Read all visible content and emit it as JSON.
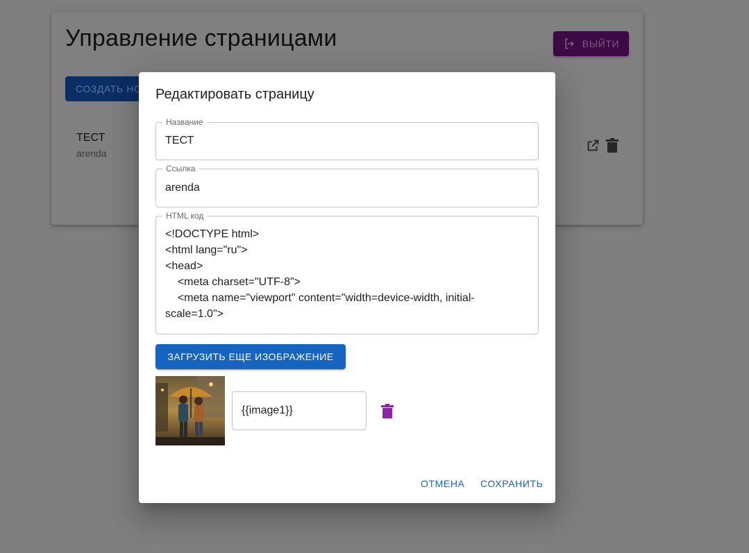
{
  "background": {
    "page_title": "Управление страницами",
    "logout_label": "ВЫЙТИ",
    "create_label": "СОЗДАТЬ НОВУЮ",
    "item_title": "ТЕСТ",
    "item_subtitle": "arenda"
  },
  "dialog": {
    "title": "Редактировать страницу",
    "name_label": "Название",
    "name_value": "ТЕСТ",
    "link_label": "Ссылка",
    "link_value": "arenda",
    "html_label": "HTML код",
    "html_value": "<!DOCTYPE html>\n<html lang=\"ru\">\n<head>\n    <meta charset=\"UTF-8\">\n    <meta name=\"viewport\" content=\"width=device-width, initial-scale=1.0\">",
    "upload_label": "ЗАГРУЗИТЬ ЕЩЕ ИЗОБРАЖЕНИЕ",
    "image_placeholder_value": "{{image1}}",
    "cancel_label": "ОТМЕНА",
    "save_label": "СОХРАНИТЬ"
  },
  "colors": {
    "primary": "#1565c0",
    "accent_purple": "#8e24aa",
    "overlay": "#7f7f7f"
  }
}
